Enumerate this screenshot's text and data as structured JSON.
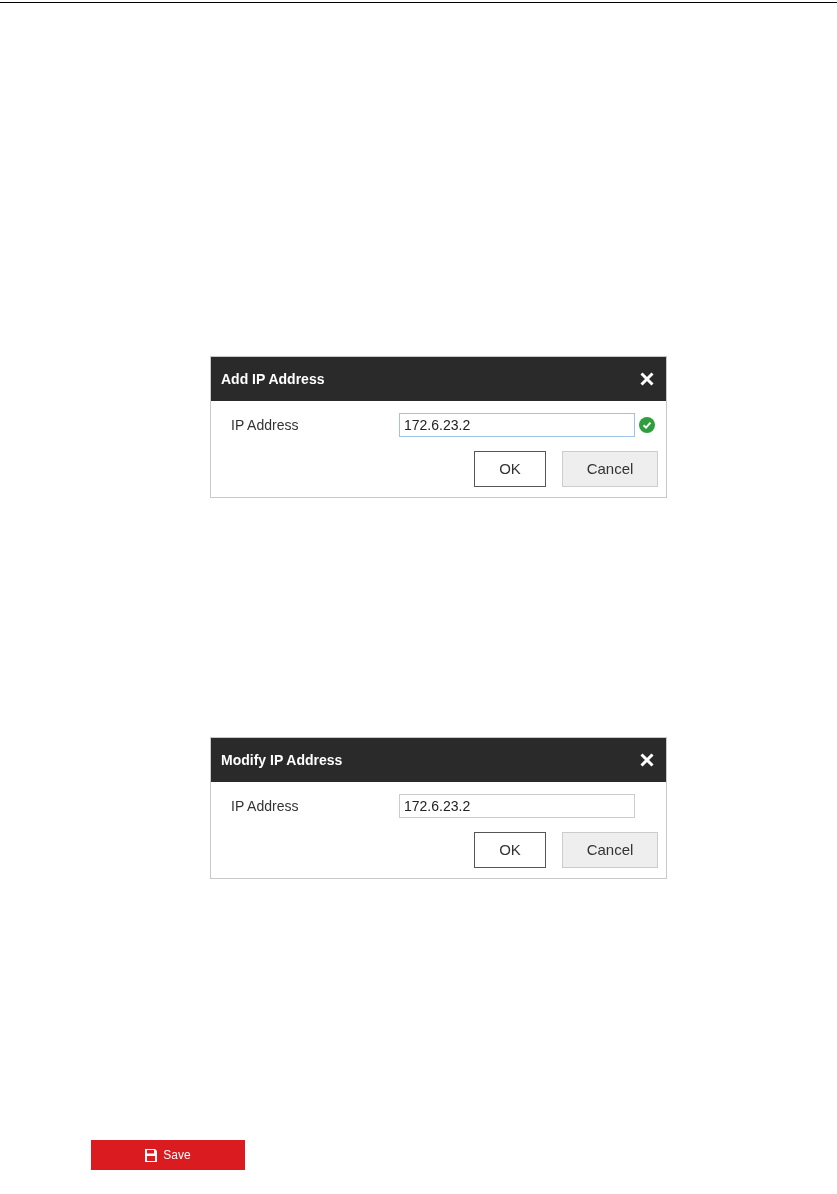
{
  "dialogs": [
    {
      "title": "Add IP Address",
      "field_label": "IP Address",
      "value": "172.6.23.2",
      "focused": true,
      "valid": true,
      "buttons": [
        {
          "label": "OK",
          "kind": "primary"
        },
        {
          "label": "Cancel",
          "kind": "secondary"
        }
      ]
    },
    {
      "title": "Modify IP Address",
      "field_label": "IP Address",
      "value": "172.6.23.2",
      "focused": false,
      "valid": false,
      "buttons": [
        {
          "label": "OK",
          "kind": "primary"
        },
        {
          "label": "Cancel",
          "kind": "secondary"
        }
      ]
    }
  ],
  "save_button": {
    "label": "Save"
  }
}
